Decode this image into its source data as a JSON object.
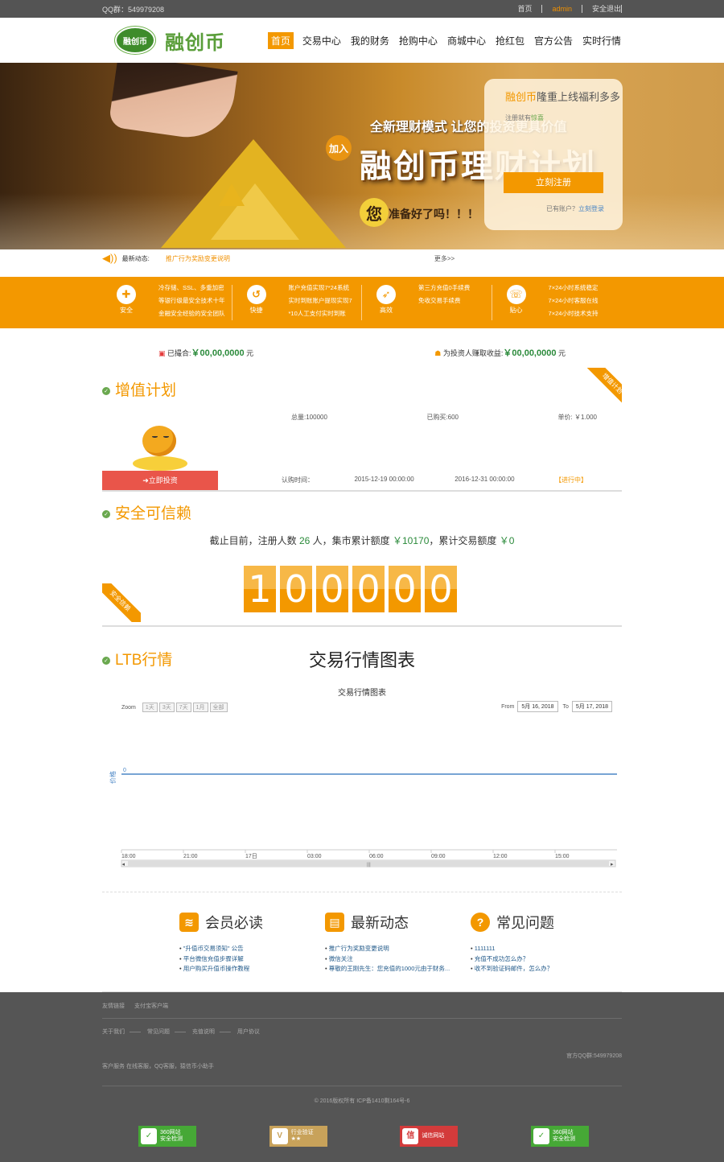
{
  "topbar": {
    "qq": "QQ群：549979208",
    "home": "首页",
    "user": "admin",
    "logout": "安全退出"
  },
  "header": {
    "logo_badge": "融创币",
    "logo_text": "融创币",
    "nav": [
      "首页",
      "交易中心",
      "我的财务",
      "抢购中心",
      "商城中心",
      "抢红包",
      "官方公告",
      "实时行情"
    ]
  },
  "banner": {
    "line1": "全新理财模式  让您的投资更具价值",
    "join": "加入",
    "title": "融创币理财计划",
    "you": "您",
    "ready": "准备好了吗！！！",
    "register_box": {
      "brand": "融创币",
      "slogan": "隆重上线福利多多",
      "gift_prefix": "注册就有",
      "gift": "惊喜",
      "register_button": "立刻注册",
      "login_prefix": "已有账户？",
      "login_link": "立刻登录"
    }
  },
  "news": {
    "label": "最新动态:",
    "item": "推广行为奖励变更说明",
    "more": "更多>>"
  },
  "features": [
    {
      "icon": "shield-icon",
      "glyph": "✚",
      "label": "安全",
      "lines": [
        "冷存储、SSL、多重加密",
        "等银行级最安全技术十年",
        "金融安全经验的安全团队"
      ]
    },
    {
      "icon": "clock-icon",
      "glyph": "↺",
      "label": "快捷",
      "lines": [
        "账户充值实现7*24系统",
        "实时到账账户提现实现7",
        "*10人工支付实时到账"
      ]
    },
    {
      "icon": "rocket-icon",
      "glyph": "➶",
      "label": "高效",
      "lines": [
        "第三方充值0手续费",
        "免收交易手续费"
      ]
    },
    {
      "icon": "support-icon",
      "glyph": "☏",
      "label": "贴心",
      "lines": [
        "7×24小时系统稳定",
        "7×24小时客服在线",
        "7×24小时技术支持"
      ]
    }
  ],
  "stats": {
    "volume_label": "已撮合:",
    "volume_value": "￥00,00,0000",
    "volume_unit": "元",
    "earn_label": "为投资人赚取收益:",
    "earn_value": "￥00,00,0000",
    "earn_unit": "元"
  },
  "plan": {
    "title": "增值计划",
    "ribbon": "增值计划",
    "total": "总量:100000",
    "bought": "已购买:600",
    "price": "单价: ￥1.000",
    "invest_button": "➜立即投资",
    "time_label": "认购时间：",
    "start": "2015-12-19 00:00:00",
    "end": "2016-12-31 00:00:00",
    "status": "【进行中】"
  },
  "trust": {
    "title": "安全可信赖",
    "prefix": "截止目前，注册人数",
    "users": "26",
    "mid1": "人，集市累计额度",
    "amount": "￥10170",
    "mid2": "，累计交易额度",
    "trade": "￥0",
    "digits": [
      "1",
      "0",
      "0",
      "0",
      "0",
      "0"
    ],
    "ribbon": "安全信赖"
  },
  "ltb": {
    "title": "LTB行情",
    "big_title": "交易行情图表",
    "chart_title": "交易行情图表",
    "zoom_label": "Zoom",
    "zoom_buttons": [
      "1天",
      "3天",
      "7天",
      "1月",
      "全部"
    ],
    "from_label": "From",
    "from_value": "5月 16, 2018",
    "to_label": "To",
    "to_value": "5月 17, 2018"
  },
  "chart_data": {
    "type": "line",
    "title": "交易行情图表",
    "ylabel": "价格",
    "x_ticks": [
      "18:00",
      "21:00",
      "17日",
      "03:00",
      "06:00",
      "09:00",
      "12:00",
      "15:00"
    ],
    "y_ticks": [
      "0"
    ],
    "series": [
      {
        "values": [
          0,
          0,
          0,
          0,
          0,
          0,
          0,
          0
        ]
      }
    ],
    "line_color": "#4a86c5"
  },
  "infos": [
    {
      "title": "会员必读",
      "glyph": "≋",
      "icon": "stack-icon",
      "items": [
        "\"升值币交易须知\" 公告",
        "平台微信充值步骤详解",
        "用户购买升值币操作教程"
      ]
    },
    {
      "title": "最新动态",
      "glyph": "▤",
      "icon": "newspaper-icon",
      "items": [
        "推广行为奖励变更说明",
        "微信关注",
        "尊敬的王刚先生：您充值的1000元由于财务..."
      ]
    },
    {
      "title": "常见问题",
      "glyph": "?",
      "icon": "question-icon",
      "items": [
        "1111111",
        "充值不成功怎么办？",
        "收不到验证码邮件，怎么办？"
      ]
    }
  ],
  "footer": {
    "friends_label": "友情链接",
    "friends": [
      "支付宝客户端"
    ],
    "links": [
      "关于我们",
      "常见问题",
      "充值说明",
      "用户协议"
    ],
    "qq": "官方QQ群:549979208",
    "service": "客户服务  在线客服，QQ客服，猿信币小助手",
    "copyright": "© 2016版权所有   ICP备1410剩164号-6",
    "badges": [
      {
        "icon": "shield-check-icon",
        "glyph": "✓",
        "line1": "360网站",
        "line2": "安全检测",
        "cls": "g"
      },
      {
        "icon": "verified-icon",
        "glyph": "V",
        "line1": "行业验证",
        "line2": "★★",
        "cls": "y"
      },
      {
        "icon": "credit-icon",
        "glyph": "信",
        "line1": "诚信网站",
        "line2": "",
        "cls": "r"
      },
      {
        "icon": "shield-check-icon",
        "glyph": "✓",
        "line1": "360网站",
        "line2": "安全检测",
        "cls": "g"
      }
    ]
  }
}
